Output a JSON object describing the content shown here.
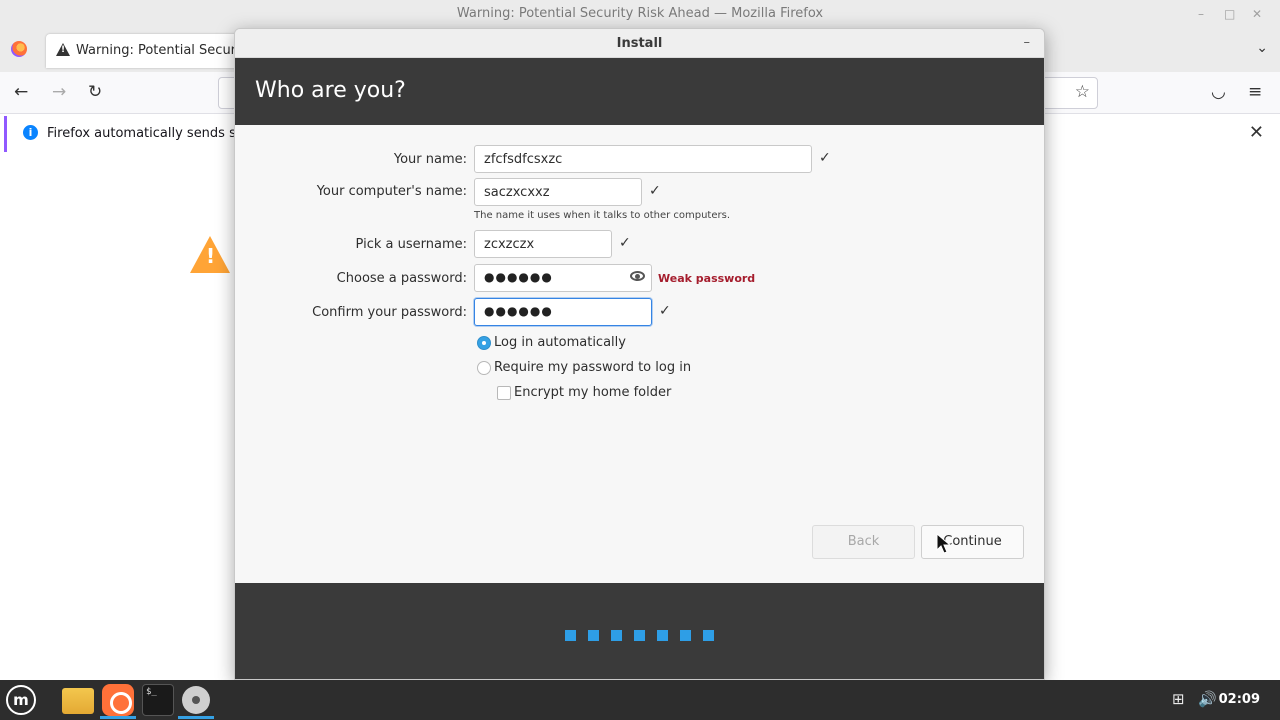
{
  "firefox": {
    "window_title": "Warning: Potential Security Risk Ahead — Mozilla Firefox",
    "tab_label": "Warning: Potential Securit",
    "notice_text": "Firefox automatically sends som",
    "icons": {
      "minimize": "–",
      "maximize": "□",
      "close": "✕",
      "tabs_dropdown": "⌄",
      "back": "←",
      "forward": "→",
      "reload": "↻",
      "bookmark_star": "☆",
      "pocket": "◡",
      "menu": "≡",
      "notice_close": "✕",
      "info": "i",
      "warning": "!"
    }
  },
  "dialog": {
    "title": "Install",
    "minimize_glyph": "–",
    "heading": "Who are you?",
    "fields": {
      "your_name": {
        "label": "Your name:",
        "value": "zfcfsdfcsxzc"
      },
      "computer_name": {
        "label": "Your computer's name:",
        "value": "saczxcxxz",
        "hint": "The name it uses when it talks to other computers."
      },
      "username": {
        "label": "Pick a username:",
        "value": "zcxzczx"
      },
      "password": {
        "label": "Choose a password:",
        "dots": "●●●●●●",
        "strength": "Weak password"
      },
      "confirm_password": {
        "label": "Confirm your password:",
        "dots": "●●●●●●"
      }
    },
    "check_glyph": "✓",
    "options": {
      "log_in_automatically": {
        "label": "Log in automatically",
        "selected": true
      },
      "require_password": {
        "label": "Require my password to log in",
        "selected": false
      },
      "encrypt_home": {
        "label": "Encrypt my home folder",
        "checked": false
      }
    },
    "buttons": {
      "back": "Back",
      "continue": "Continue"
    },
    "progress_steps": 7
  },
  "taskbar": {
    "menu_glyph": "m",
    "terminal_glyph": "$_",
    "tray": {
      "network": "⊞",
      "volume": "🔊"
    },
    "clock": "02:09"
  },
  "colors": {
    "accent": "#35a1e4",
    "header_dark": "#3a3a3a",
    "weak_password": "#a51d2d",
    "warning_orange": "#ffa436"
  }
}
